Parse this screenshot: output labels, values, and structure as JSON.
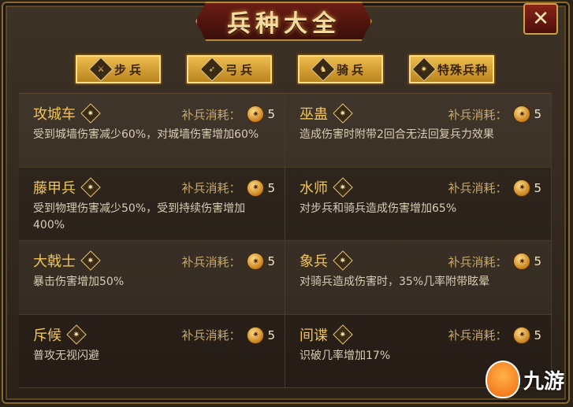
{
  "title": "兵种大全",
  "close_icon": "close-icon",
  "tabs": [
    {
      "label": "步兵",
      "icon": "infantry-icon"
    },
    {
      "label": "弓兵",
      "icon": "archer-icon"
    },
    {
      "label": "骑兵",
      "icon": "cavalry-icon"
    },
    {
      "label": "特殊兵种",
      "icon": "special-icon"
    }
  ],
  "cost_label": "补兵消耗：",
  "units": [
    {
      "name": "攻城车",
      "cost": "5",
      "desc": "受到城墙伤害减少60%，对城墙伤害增加60%"
    },
    {
      "name": "巫蛊",
      "cost": "5",
      "desc": "造成伤害时附带2回合无法回复兵力效果"
    },
    {
      "name": "藤甲兵",
      "cost": "5",
      "desc": "受到物理伤害减少50%，受到持续伤害增加400%"
    },
    {
      "name": "水师",
      "cost": "5",
      "desc": "对步兵和骑兵造成伤害增加65%"
    },
    {
      "name": "大戟士",
      "cost": "5",
      "desc": "暴击伤害增加50%"
    },
    {
      "name": "象兵",
      "cost": "5",
      "desc": "对骑兵造成伤害时，35%几率附带眩晕"
    },
    {
      "name": "斥候",
      "cost": "5",
      "desc": "普攻无视闪避"
    },
    {
      "name": "间谍",
      "cost": "5",
      "desc": "识破几率增加17%"
    }
  ],
  "watermark": "九游"
}
